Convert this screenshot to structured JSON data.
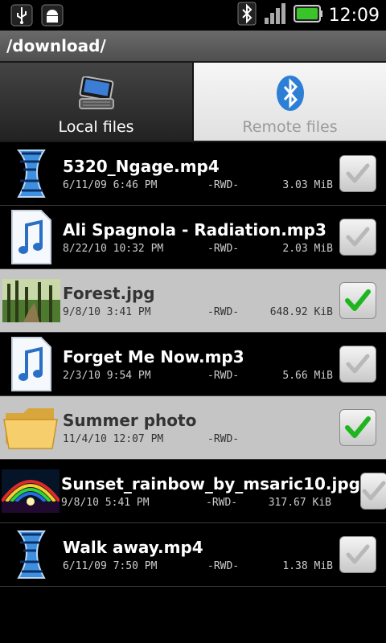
{
  "status": {
    "time": "12:09"
  },
  "path": "/download/",
  "tabs": [
    {
      "label": "Local files",
      "active": true,
      "icon": "device-icon"
    },
    {
      "label": "Remote files",
      "active": false,
      "icon": "bluetooth-icon"
    }
  ],
  "files": [
    {
      "name": "5320_Ngage.mp4",
      "date": "6/11/09 6:46 PM",
      "perm": "-RWD-",
      "size": "3.03 MiB",
      "type": "video",
      "checked": false
    },
    {
      "name": "Ali Spagnola - Radiation.mp3",
      "date": "8/22/10 10:32 PM",
      "perm": "-RWD-",
      "size": "2.03 MiB",
      "type": "audio",
      "checked": false
    },
    {
      "name": "Forest.jpg",
      "date": "9/8/10 3:41 PM",
      "perm": "-RWD-",
      "size": "648.92 KiB",
      "type": "image-forest",
      "checked": true
    },
    {
      "name": "Forget Me Now.mp3",
      "date": "2/3/10 9:54 PM",
      "perm": "-RWD-",
      "size": "5.66 MiB",
      "type": "audio",
      "checked": false
    },
    {
      "name": "Summer photo",
      "date": "11/4/10 12:07 PM",
      "perm": "-RWD-",
      "size": "",
      "type": "folder",
      "checked": true
    },
    {
      "name": "Sunset_rainbow_by_msaric10.jpg",
      "date": "9/8/10 5:41 PM",
      "perm": "-RWD-",
      "size": "317.67 KiB",
      "type": "image-sunset",
      "checked": false
    },
    {
      "name": "Walk away.mp4",
      "date": "6/11/09 7:50 PM",
      "perm": "-RWD-",
      "size": "1.38 MiB",
      "type": "video",
      "checked": false
    }
  ],
  "colors": {
    "check_green": "#1fb51f",
    "selected_row": "#c5c5c5",
    "battery": "#39c52a"
  }
}
